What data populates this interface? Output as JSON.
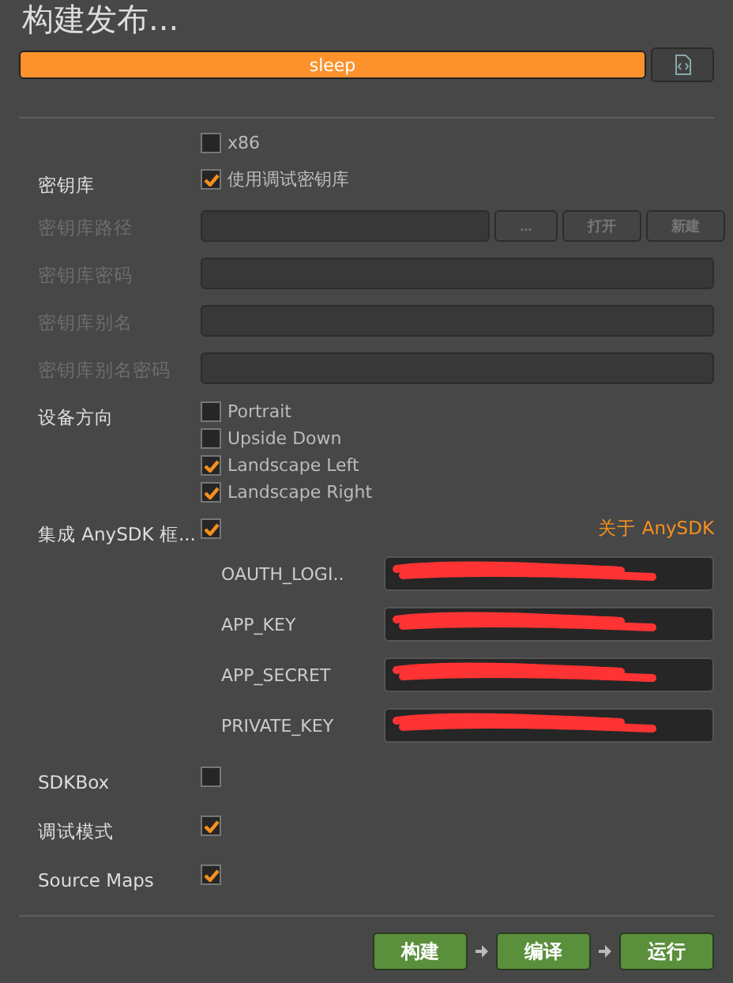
{
  "title": "构建发布...",
  "progress": {
    "label": "sleep",
    "level": 1
  },
  "rows": [
    {
      "kind": "checks",
      "items": [
        {
          "text": "x86",
          "checked": false
        }
      ]
    },
    {
      "kind": "checks",
      "label": "密钥库",
      "items": [
        {
          "text": "使用调试密钥库",
          "checked": true
        }
      ]
    },
    {
      "kind": "path",
      "label": "密钥库路径",
      "disabled": true,
      "buttons": [
        "...",
        "打开",
        "新建"
      ]
    },
    {
      "kind": "field",
      "label": "密钥库密码",
      "disabled": true
    },
    {
      "kind": "field",
      "label": "密钥库别名",
      "disabled": true
    },
    {
      "kind": "field",
      "label": "密钥库别名密码",
      "disabled": true
    },
    {
      "kind": "checks",
      "label": "设备方向",
      "items": [
        {
          "text": "Portrait",
          "checked": false
        },
        {
          "text": "Upside Down",
          "checked": false
        },
        {
          "text": "Landscape Left",
          "checked": true
        },
        {
          "text": "Landscape Right",
          "checked": true
        }
      ]
    },
    {
      "kind": "sdk",
      "label": "集成 AnySDK 框...",
      "checked": true,
      "link": "关于 AnySDK",
      "params": [
        {
          "name": "OAUTH_LOGI..",
          "redacted": true
        },
        {
          "name": "APP_KEY",
          "redacted": true
        },
        {
          "name": "APP_SECRET",
          "redacted": true
        },
        {
          "name": "PRIVATE_KEY",
          "redacted": true
        }
      ]
    },
    {
      "kind": "checks",
      "label": "SDKBox",
      "items": [
        {
          "checked": false
        }
      ]
    },
    {
      "kind": "checks",
      "label": "调试模式",
      "items": [
        {
          "checked": true
        }
      ]
    },
    {
      "kind": "checks",
      "label": "Source Maps",
      "items": [
        {
          "checked": true
        }
      ]
    }
  ],
  "steps": [
    "构建",
    "编译",
    "运行"
  ]
}
